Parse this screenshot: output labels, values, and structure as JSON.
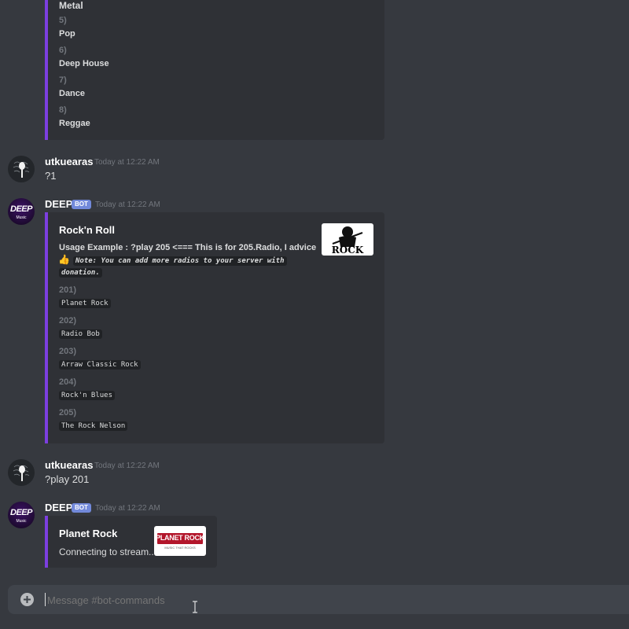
{
  "top_embed": {
    "items": [
      {
        "label": "Metal"
      },
      {
        "num": "5)",
        "label": "Pop"
      },
      {
        "num": "6)",
        "label": "Deep House"
      },
      {
        "num": "7)",
        "label": "Dance"
      },
      {
        "num": "8)",
        "label": "Reggae"
      }
    ]
  },
  "messages": [
    {
      "author": "utkuearas",
      "timestamp": "Today at 12:22 AM",
      "text": "?1"
    },
    {
      "author": "DEEP",
      "badge": "BOT",
      "timestamp": "Today at 12:22 AM",
      "embed": {
        "title": "Rock'n Roll",
        "usage": "Usage Example : ?play 205 <=== This is for 205.Radio, I advice",
        "thumbs_up_icon": "👍",
        "note_line1": "Note: You can add more radios to your server with",
        "note_line2": "donation.",
        "stations": [
          {
            "num": "201)",
            "name": "Planet Rock"
          },
          {
            "num": "202)",
            "name": "Radio Bob"
          },
          {
            "num": "203)",
            "name": "Arraw Classic Rock"
          },
          {
            "num": "204)",
            "name": "Rock'n Blues"
          },
          {
            "num": "205)",
            "name": "The Rock Nelson"
          }
        ],
        "thumbnail_text": "ROCK"
      }
    },
    {
      "author": "utkuearas",
      "timestamp": "Today at 12:22 AM",
      "text": "?play 201"
    },
    {
      "author": "DEEP",
      "badge": "BOT",
      "timestamp": "Today at 12:22 AM",
      "embed": {
        "title": "Planet Rock",
        "description": "Connecting to stream...",
        "thumbnail_text": "PLANET ROCK",
        "thumbnail_subtext": "MUSIC THAT ROCKS"
      }
    }
  ],
  "bot_avatar": {
    "line1": "DEEP",
    "line2": "Music"
  },
  "composer": {
    "placeholder": "Message #bot-commands",
    "add_icon": "plus-circle-icon"
  },
  "colors": {
    "background": "#36393f",
    "embed_bg": "#2f3136",
    "embed_border": "#7c3fe0",
    "badge": "#7289da"
  }
}
